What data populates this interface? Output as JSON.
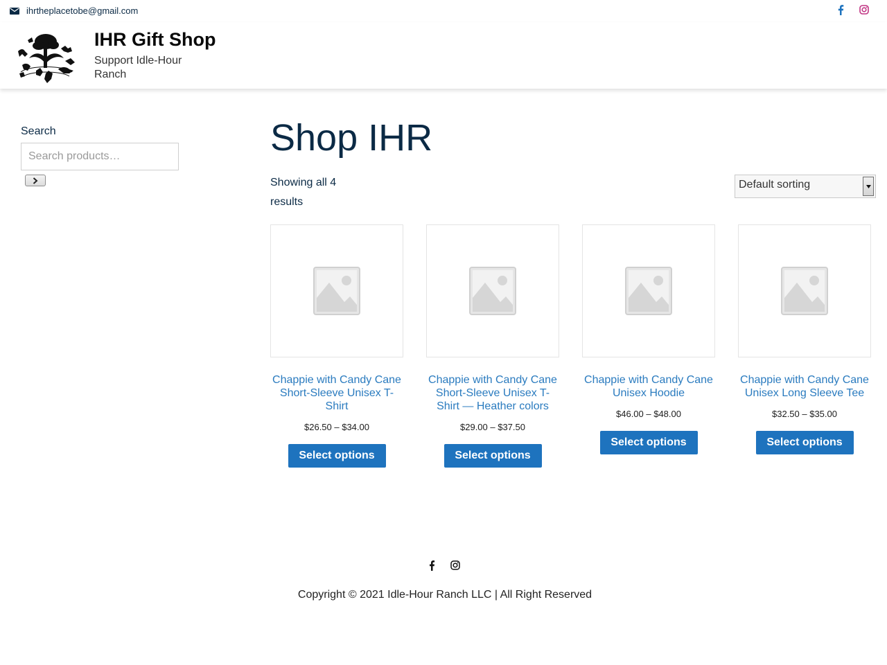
{
  "topbar": {
    "email": "ihrtheplacetobe@gmail.com",
    "icons": [
      "envelope-icon",
      "facebook-icon",
      "instagram-icon"
    ],
    "facebook_color": "#1e73be",
    "instagram_color": "#c13584"
  },
  "header": {
    "site_title": "IHR Gift Shop",
    "tagline": "Support Idle-Hour Ranch"
  },
  "sidebar": {
    "search_label": "Search",
    "search_placeholder": "Search products…"
  },
  "main": {
    "title": "Shop IHR",
    "result_count": "Showing all 4 results",
    "sort_selected": "Default sorting",
    "products": [
      {
        "name": "Chappie with Candy Cane Short-Sleeve Unisex T-Shirt",
        "price": "$26.50 – $34.00",
        "button": "Select options"
      },
      {
        "name": "Chappie with Candy Cane Short-Sleeve Unisex T-Shirt — Heather colors",
        "price": "$29.00 – $37.50",
        "button": "Select options"
      },
      {
        "name": "Chappie with Candy Cane Unisex Hoodie",
        "price": "$46.00 – $48.00",
        "button": "Select options"
      },
      {
        "name": "Chappie with Candy Cane Unisex Long Sleeve Tee",
        "price": "$32.50 – $35.00",
        "button": "Select options"
      }
    ]
  },
  "footer": {
    "copyright": "Copyright © 2021 Idle-Hour Ranch LLC | All Right Reserved"
  },
  "colors": {
    "heading": "#0b2a45",
    "link": "#2a7bbf",
    "button": "#1e73be"
  }
}
